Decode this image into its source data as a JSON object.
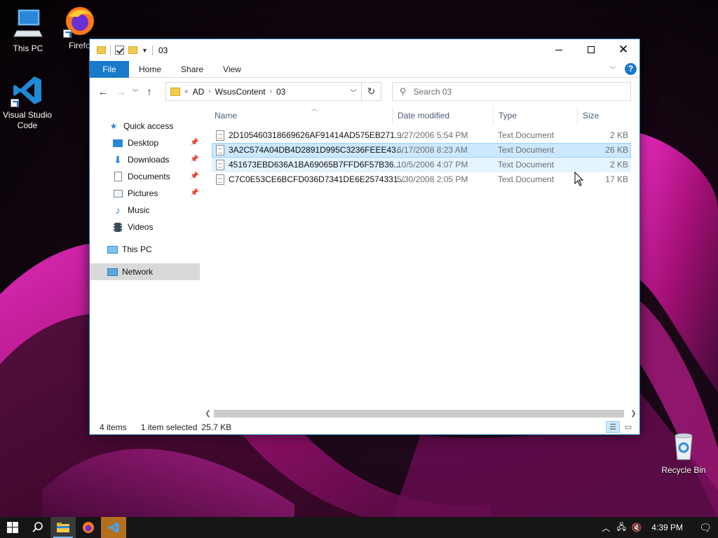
{
  "desktop": {
    "icons": [
      {
        "label": "This PC"
      },
      {
        "label": "Firefo"
      },
      {
        "label": "Visual Studio Code"
      },
      {
        "label": "Recycle Bin"
      }
    ]
  },
  "window": {
    "title": "03",
    "ribbon_tabs": [
      "File",
      "Home",
      "Share",
      "View"
    ],
    "address": {
      "overflow": "«",
      "parts": [
        "AD",
        "WsusContent",
        "03"
      ]
    },
    "search": {
      "placeholder": "Search 03"
    },
    "columns": {
      "name": "Name",
      "date": "Date modified",
      "type": "Type",
      "size": "Size"
    },
    "sidebar": {
      "quick_access": "Quick access",
      "items": [
        "Desktop",
        "Downloads",
        "Documents",
        "Pictures",
        "Music",
        "Videos"
      ],
      "this_pc": "This PC",
      "network": "Network"
    },
    "files": [
      {
        "name": "2D105460318669626AF91414AD575EB271...",
        "date": "9/27/2006 5:54 PM",
        "type": "Text Document",
        "size": "2 KB",
        "state": "normal"
      },
      {
        "name": "3A2C574A04DB4D2891D995C3236FEEE43...",
        "date": "6/17/2008 8:23 AM",
        "type": "Text Document",
        "size": "26 KB",
        "state": "selected"
      },
      {
        "name": "451673EBD636A1BA69065B7FFD6F57B36...",
        "date": "10/5/2006 4:07 PM",
        "type": "Text Document",
        "size": "2 KB",
        "state": "hover"
      },
      {
        "name": "C7C0E53CE6BCFD036D7341DE6E2574331...",
        "date": "5/30/2008 2:05 PM",
        "type": "Text Document",
        "size": "17 KB",
        "state": "normal"
      }
    ],
    "status": {
      "count": "4 items",
      "selected": "1 item selected",
      "size": "25.7 KB"
    }
  },
  "taskbar": {
    "clock": "4:39 PM",
    "accent": "#1979ca"
  }
}
